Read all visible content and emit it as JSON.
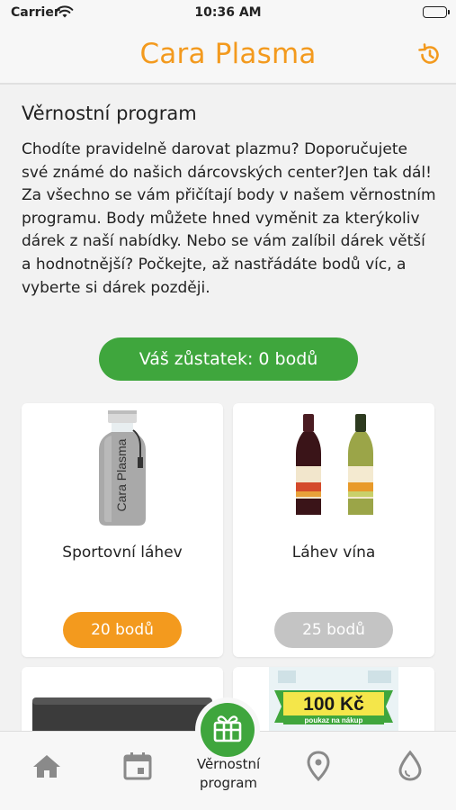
{
  "status_bar": {
    "carrier": "Carrier",
    "time": "10:36 AM"
  },
  "header": {
    "title": "Cara Plasma",
    "history_icon": "history-icon"
  },
  "section": {
    "title": "Věrnostní program",
    "intro": "Chodíte pravidelně darovat plazmu? Doporučujete své známé do našich dárcovských center?Jen tak dál! Za všechno se vám přičítají body v našem věrnostním programu. Body můžete hned vyměnit za kterýkoliv dárek z naší nabídky. Nebo se vám zalíbil dárek větší a hodnotnější? Počkejte, až nastřádáte bodů víc, a vyberte si dárek později."
  },
  "balance": {
    "label": "Váš zůstatek: 0 bodů"
  },
  "rewards": [
    {
      "name": "Sportovní láhev",
      "points": "20 bodů",
      "state": "active",
      "bottle_text": "Cara Plasma"
    },
    {
      "name": "Láhev vína",
      "points": "25 bodů",
      "state": "inactive"
    },
    {
      "name": "",
      "points": "",
      "state": "partial"
    },
    {
      "name": "",
      "points": "",
      "state": "partial",
      "voucher_value": "100 Kč",
      "voucher_sub": "poukaz na nákup"
    }
  ],
  "tabbar": {
    "items": [
      {
        "icon": "home-icon"
      },
      {
        "icon": "calendar-icon"
      },
      {
        "icon": "gift-icon",
        "label": "Věrnostní program"
      },
      {
        "icon": "location-pin-icon"
      },
      {
        "icon": "drop-icon"
      }
    ]
  },
  "colors": {
    "accent": "#f39a1e",
    "green": "#3fa63d",
    "disabled": "#c4c4c4"
  }
}
